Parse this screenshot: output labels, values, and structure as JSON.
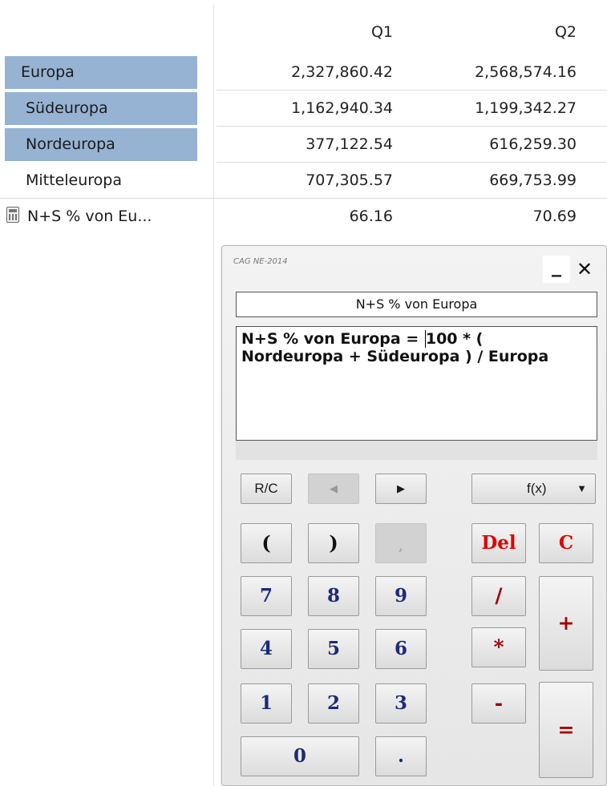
{
  "header": {
    "q1": "Q1",
    "q2": "Q2"
  },
  "rows": [
    {
      "label": "Europa",
      "q1": "2,327,860.42",
      "q2": "2,568,574.16"
    },
    {
      "label": "Südeuropa",
      "q1": "1,162,940.34",
      "q2": "1,199,342.27"
    },
    {
      "label": "Nordeuropa",
      "q1": "377,122.54",
      "q2": "616,259.30"
    },
    {
      "label": "Mitteleuropa",
      "q1": "707,305.57",
      "q2": "669,753.99"
    },
    {
      "label": "N+S % von Eu...",
      "q1": "66.16",
      "q2": "70.69"
    }
  ],
  "calculator": {
    "brand": "CAG NE-2014",
    "minimize": "_",
    "close": "✕",
    "name": "N+S % von Europa",
    "formula_line1": "N+S % von Europa = ",
    "formula_line1b": "100 * (",
    "formula_line2": "Nordeuropa + Südeuropa ) / Europa",
    "buttons": {
      "rc": "R/C",
      "left": "◀",
      "right": "▶",
      "fx": "f(x)",
      "fx_arrow": "▼",
      "lparen": "(",
      "rparen": ")",
      "comma": ",",
      "del": "Del",
      "clear": "C",
      "n7": "7",
      "n8": "8",
      "n9": "9",
      "div": "/",
      "plus": "+",
      "n4": "4",
      "n5": "5",
      "n6": "6",
      "mul": "*",
      "n1": "1",
      "n2": "2",
      "n3": "3",
      "minus": "-",
      "eq": "=",
      "n0": "0",
      "dot": "."
    }
  }
}
